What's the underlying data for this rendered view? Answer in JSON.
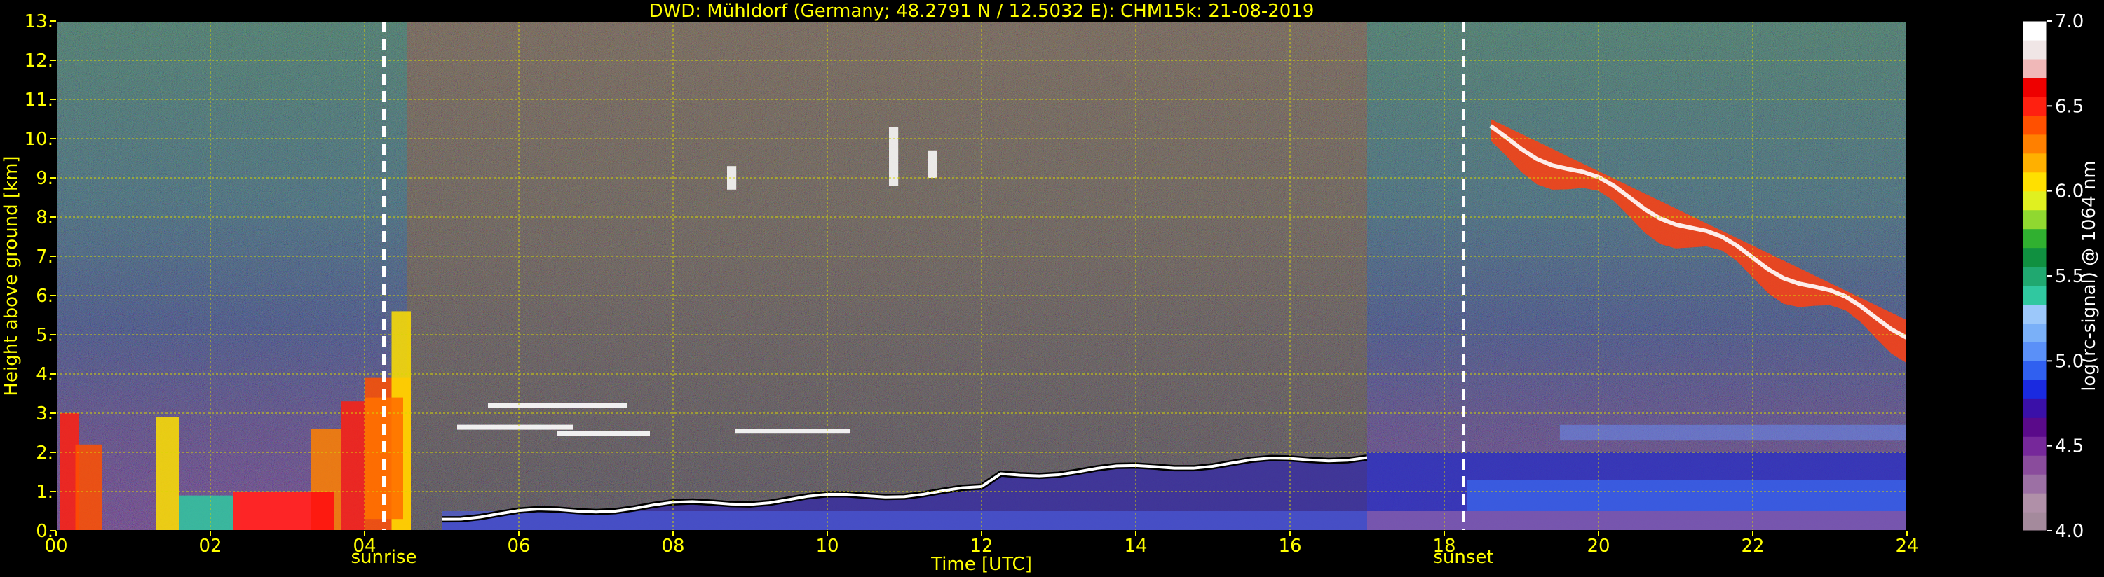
{
  "chart_data": {
    "type": "heatmap",
    "title": "DWD: Mühldorf (Germany; 48.2791 N / 12.5032 E):    CHM15k: 21-08-2019",
    "xlabel": "Time [UTC]",
    "ylabel": "Height above ground [km]",
    "xlim": [
      0,
      24
    ],
    "ylim": [
      0,
      13
    ],
    "x_ticks": [
      "00",
      "02",
      "04",
      "06",
      "08",
      "10",
      "12",
      "14",
      "16",
      "18",
      "20",
      "22",
      "24"
    ],
    "y_ticks": [
      "0.",
      "1.",
      "2.",
      "3.",
      "4.",
      "5.",
      "6.",
      "7.",
      "8.",
      "9.",
      "10.",
      "11.",
      "12.",
      "13."
    ],
    "grid": true,
    "colorbar": {
      "label": "log(rc-signal) @ 1064 nm",
      "range": [
        4.0,
        7.0
      ],
      "ticks": [
        "4.0",
        "4.5",
        "5.0",
        "5.5",
        "6.0",
        "6.5",
        "7.0"
      ],
      "colors": [
        "#a48a9c",
        "#b090a8",
        "#9c70a4",
        "#8a4c9c",
        "#76289a",
        "#5a0a8a",
        "#3a10a8",
        "#1a2ae0",
        "#3060f0",
        "#5a90f8",
        "#7ab0f8",
        "#9cc8fa",
        "#30c8a0",
        "#20a870",
        "#109040",
        "#30b030",
        "#90d830",
        "#e0f020",
        "#ffe000",
        "#ffb000",
        "#ff8000",
        "#ff5000",
        "#ff2010",
        "#ee0000",
        "#f0b8b8",
        "#f0e6e6",
        "#ffffff"
      ]
    },
    "annotations": [
      {
        "label": "sunrise",
        "time_utc": 4.25
      },
      {
        "label": "sunset",
        "time_utc": 18.25
      }
    ],
    "features": [
      {
        "desc": "boundary layer aerosol top",
        "time": [
          5.0,
          17.0
        ],
        "height_km": [
          0.4,
          2.0
        ]
      },
      {
        "desc": "low clouds / precipitation",
        "time": [
          0.0,
          4.6
        ],
        "height_km": [
          0.0,
          3.2
        ]
      },
      {
        "desc": "cirrus band",
        "time": [
          18.5,
          24.0
        ],
        "height_km": [
          4.6,
          10.5
        ]
      }
    ]
  }
}
